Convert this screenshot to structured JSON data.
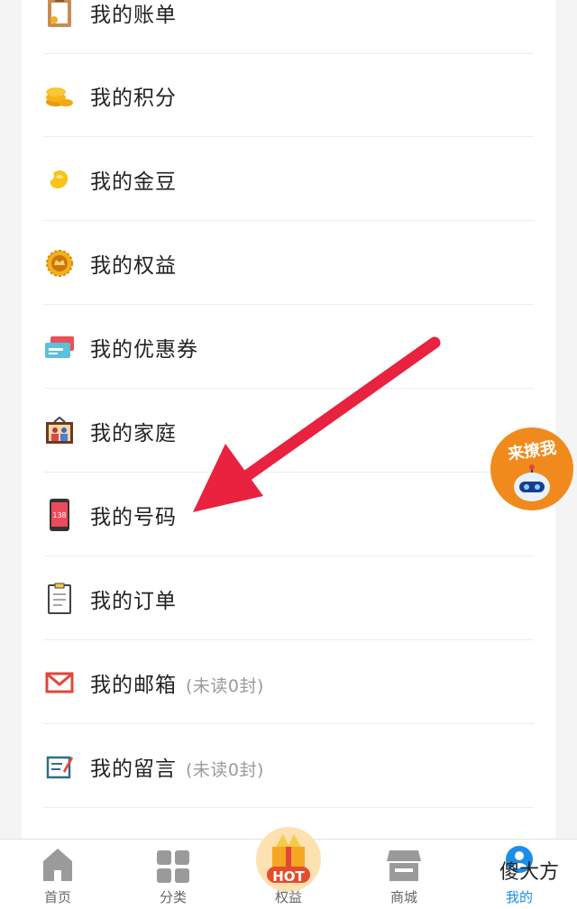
{
  "menu": {
    "items": [
      {
        "label": "我的账单",
        "icon": "bill-clipboard-icon"
      },
      {
        "label": "我的积分",
        "icon": "coins-icon"
      },
      {
        "label": "我的金豆",
        "icon": "gold-bean-icon"
      },
      {
        "label": "我的权益",
        "icon": "rights-medal-icon"
      },
      {
        "label": "我的优惠券",
        "icon": "coupon-cards-icon"
      },
      {
        "label": "我的家庭",
        "icon": "family-photo-icon"
      },
      {
        "label": "我的号码",
        "icon": "phone-number-icon",
        "icon_text": "138"
      },
      {
        "label": "我的订单",
        "icon": "order-clipboard-icon"
      },
      {
        "label": "我的邮箱",
        "icon": "mail-envelope-icon",
        "sub": "(未读0封)"
      },
      {
        "label": "我的留言",
        "icon": "message-board-icon",
        "sub": "(未读0封)"
      }
    ]
  },
  "floating_badge": {
    "text": "来撩我",
    "icon": "robot-mascot-icon"
  },
  "tabbar": {
    "tabs": [
      {
        "label": "首页",
        "icon": "home-icon"
      },
      {
        "label": "分类",
        "icon": "grid-icon"
      },
      {
        "label": "权益",
        "icon": "hot-gift-icon",
        "badge": "HOT"
      },
      {
        "label": "商城",
        "icon": "store-icon"
      },
      {
        "label": "我的",
        "icon": "profile-icon",
        "active": true
      }
    ]
  },
  "watermark": "傻大方",
  "colors": {
    "accent": "#1a8ee8",
    "arrow": "#e8223f",
    "hot": "#e84a2c"
  }
}
